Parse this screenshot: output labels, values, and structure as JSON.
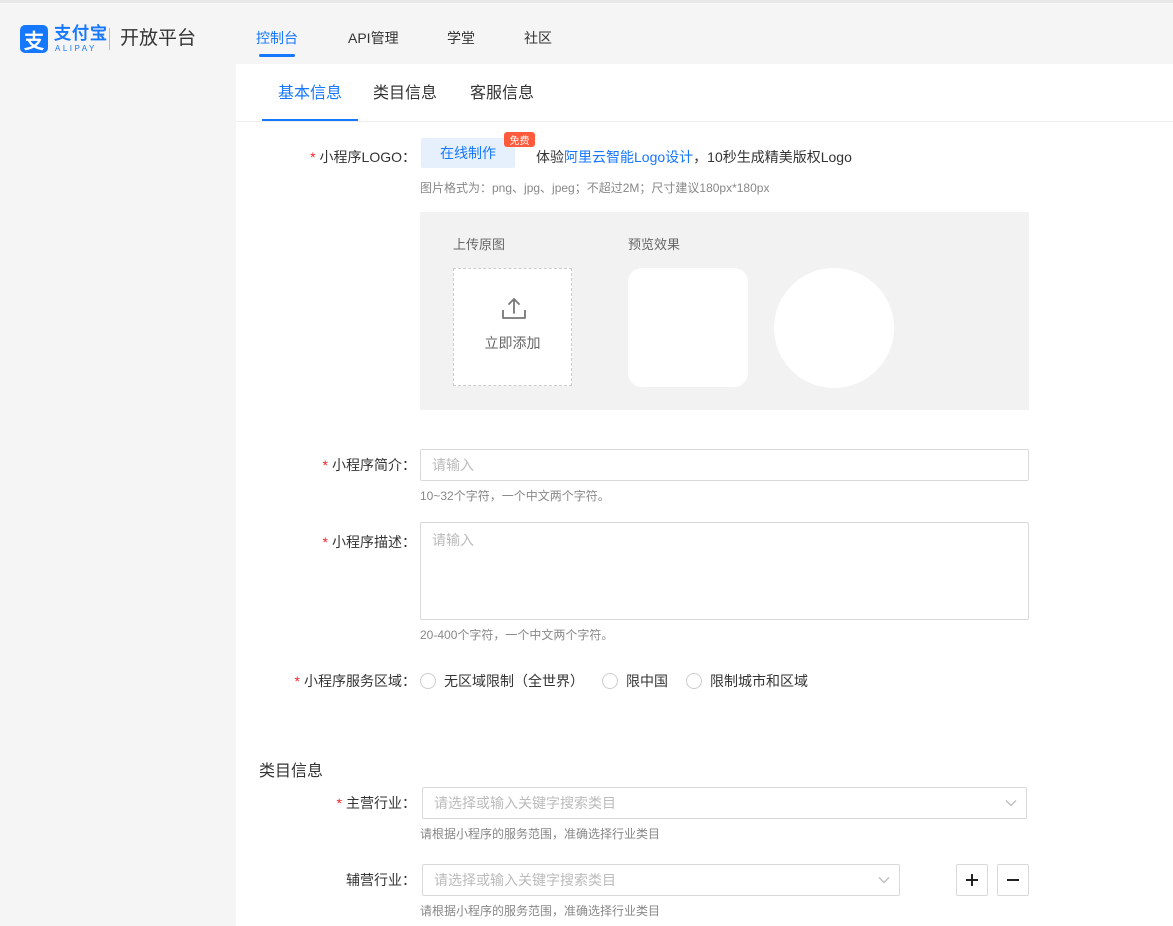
{
  "header": {
    "brand_cn": "支付宝",
    "brand_en": "ALIPAY",
    "brand_icon": "支",
    "platform": "开放平台",
    "nav": [
      "控制台",
      "API管理",
      "学堂",
      "社区"
    ]
  },
  "tabs": [
    "基本信息",
    "类目信息",
    "客服信息"
  ],
  "logo": {
    "label": "小程序LOGO",
    "make_button": "在线制作",
    "badge": "免费",
    "promo_prefix": "体验",
    "promo_link": "阿里云智能Logo设计",
    "promo_suffix": "，10秒生成精美版权Logo",
    "hint": "图片格式为：png、jpg、jpeg；不超过2M；尺寸建议180px*180px",
    "upload_title": "上传原图",
    "preview_title": "预览效果",
    "upload_text": "立即添加"
  },
  "intro": {
    "label": "小程序简介",
    "placeholder": "请输入",
    "hint": "10~32个字符，一个中文两个字符。"
  },
  "desc": {
    "label": "小程序描述",
    "placeholder": "请输入",
    "hint": "20-400个字符，一个中文两个字符。"
  },
  "region": {
    "label": "小程序服务区域",
    "options": [
      "无区域限制（全世界）",
      "限中国",
      "限制城市和区域"
    ]
  },
  "category": {
    "title": "类目信息",
    "main_label": "主营行业",
    "main_placeholder": "请选择或输入关键字搜索类目",
    "main_hint": "请根据小程序的服务范围，准确选择行业类目",
    "sub_label": "辅营行业",
    "sub_placeholder": "请选择或输入关键字搜索类目",
    "sub_hint": "请根据小程序的服务范围，准确选择行业类目"
  },
  "colors": {
    "accent": "#1677ff",
    "required": "#f5222d",
    "badge": "#ff5a3c"
  }
}
